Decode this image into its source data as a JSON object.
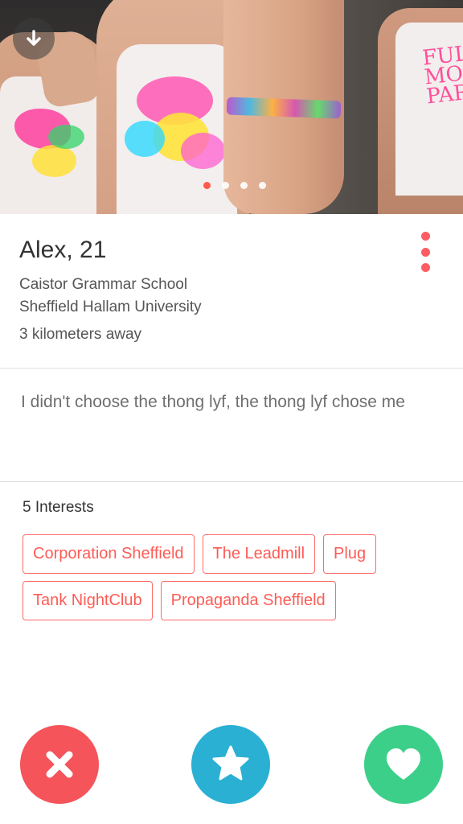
{
  "photo": {
    "tank_right_text": "FULL MOO PAR",
    "carousel": {
      "count": 4,
      "active_index": 0
    }
  },
  "profile": {
    "name_age": "Alex, 21",
    "schools": [
      "Caistor Grammar School",
      "Sheffield Hallam University"
    ],
    "distance": "3 kilometers away",
    "bio": "I didn't choose the thong lyf, the thong lyf chose me"
  },
  "interests": {
    "title": "5 Interests",
    "items": [
      "Corporation Sheffield",
      "The Leadmill",
      "Plug",
      "Tank NightClub",
      "Propaganda Sheffield"
    ]
  },
  "actions": {
    "nope_icon": "close-icon",
    "superlike_icon": "star-icon",
    "like_icon": "heart-icon"
  },
  "colors": {
    "accent": "#fd5c62",
    "nope": "#f4545a",
    "superlike": "#2ab0d3",
    "like": "#3ccf8a"
  }
}
